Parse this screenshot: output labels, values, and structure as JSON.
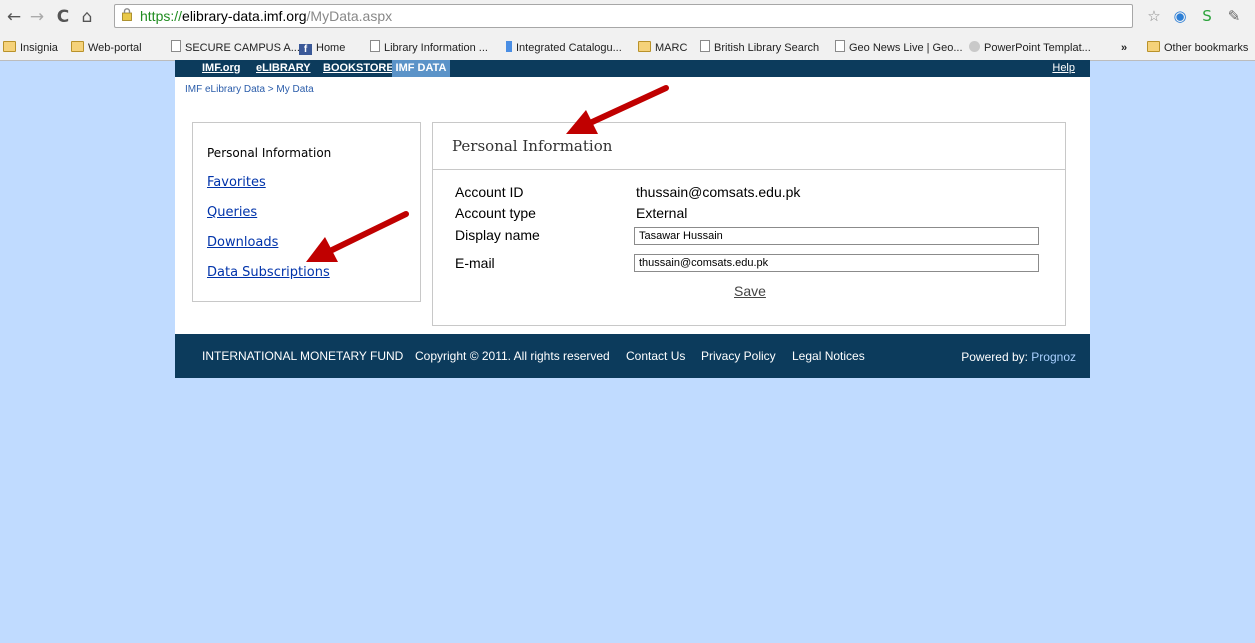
{
  "browser": {
    "url_scheme": "https://",
    "url_host": "elibrary-data.imf.org",
    "url_path": "/MyData.aspx",
    "bookmarks": [
      {
        "label": "Insignia",
        "icon": "folder-icon"
      },
      {
        "label": "Web-portal",
        "icon": "folder-icon"
      },
      {
        "label": "SECURE CAMPUS A...",
        "icon": "page-icon"
      },
      {
        "label": "Home",
        "icon": "facebook-icon"
      },
      {
        "label": "Library Information ...",
        "icon": "page-icon"
      },
      {
        "label": "Integrated Catalogu...",
        "icon": "bookmark-icon"
      },
      {
        "label": "MARC",
        "icon": "folder-icon"
      },
      {
        "label": "British Library Search",
        "icon": "page-icon"
      },
      {
        "label": "Geo News Live | Geo...",
        "icon": "page-icon"
      },
      {
        "label": "PowerPoint Templat...",
        "icon": "globe-icon"
      }
    ],
    "overflow": "»",
    "other_bookmarks": "Other bookmarks"
  },
  "topnav": {
    "links": [
      "IMF.org",
      "eLIBRARY",
      "BOOKSTORE"
    ],
    "active": "IMF DATA",
    "help": "Help"
  },
  "breadcrumb": "IMF eLibrary Data > My Data",
  "sidebar": {
    "title": "Personal Information",
    "links": [
      "Favorites",
      "Queries",
      "Downloads",
      "Data Subscriptions"
    ]
  },
  "main": {
    "title": "Personal Information",
    "account_id_label": "Account ID",
    "account_id_value": "thussain@comsats.edu.pk",
    "account_type_label": "Account type",
    "account_type_value": "External",
    "display_name_label": "Display name",
    "display_name_value": "Tasawar Hussain",
    "email_label": "E-mail",
    "email_value": "thussain@comsats.edu.pk",
    "save_label": "Save"
  },
  "footer": {
    "org": "INTERNATIONAL MONETARY FUND",
    "copyright": "Copyright © 2011. All rights reserved",
    "contact": "Contact Us",
    "privacy": "Privacy Policy",
    "legal": "Legal Notices",
    "powered_prefix": "Powered by:",
    "powered_brand": "Prognoz"
  },
  "colors": {
    "background": "#c0dbff",
    "nav_bar": "#0c3b5c",
    "active_tab": "#5b93c8",
    "annotation_arrow": "#c00000"
  }
}
